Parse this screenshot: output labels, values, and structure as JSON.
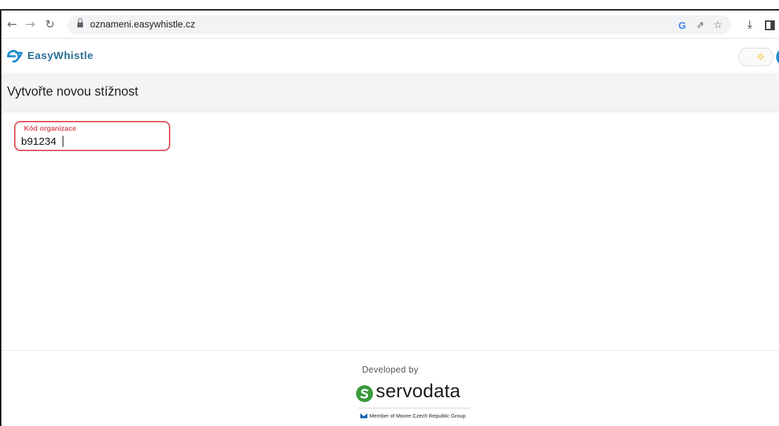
{
  "browser": {
    "url": "oznameni.easywhistle.cz",
    "icons": {
      "back": "←",
      "forward": "→",
      "reload": "↻",
      "google": "G",
      "share": "⇗",
      "star": "☆",
      "download": "⤓"
    }
  },
  "app": {
    "brand": "EasyWhistle",
    "logo_color": "#1f8acb",
    "theme_icon": "☼"
  },
  "page": {
    "title": "Vytvořte novou stížnost"
  },
  "form": {
    "org_code_label": "Kód organizace",
    "org_code_value": "b91234",
    "error_color": "#e2555e"
  },
  "footer": {
    "developed_by": "Developed by",
    "brand_name": "servodata",
    "member_text": "Member of Moore Czech Republic Group",
    "brand_color": "#3a9a3c"
  }
}
